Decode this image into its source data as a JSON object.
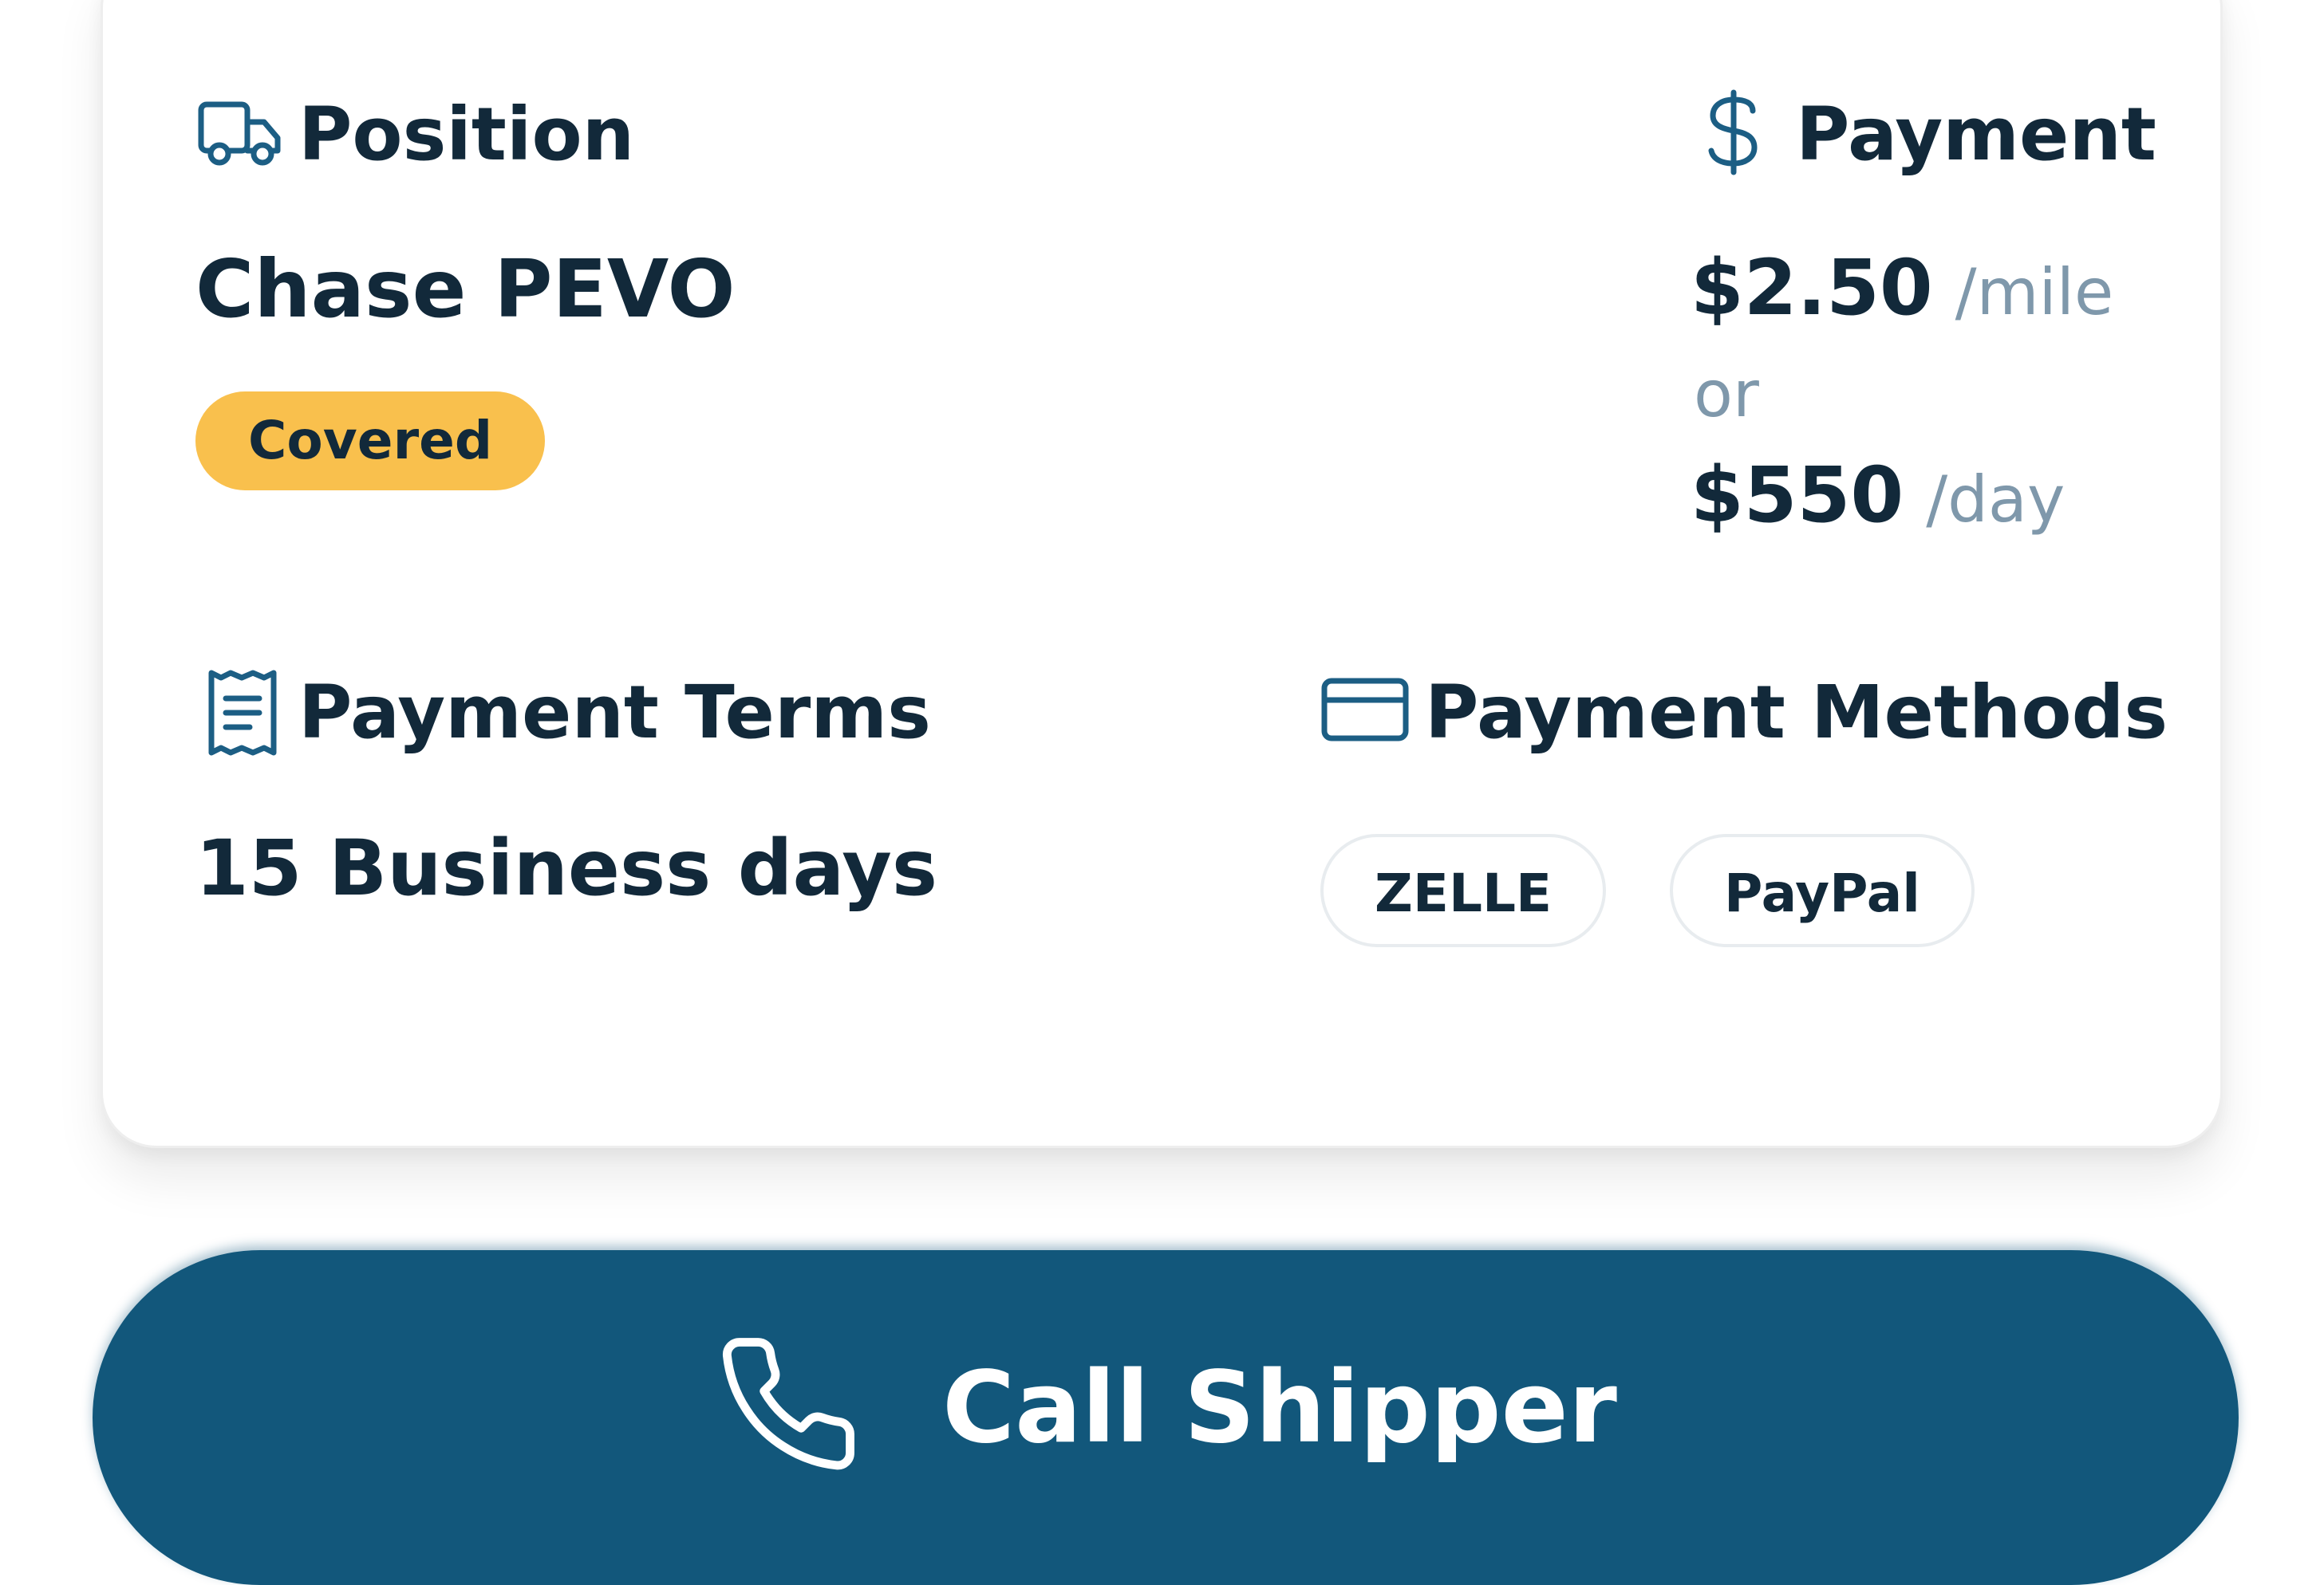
{
  "position": {
    "title": "Position",
    "icon": "truck-icon",
    "value": "Chase PEVO",
    "badge": "Covered",
    "badge_color": "#f9c04d"
  },
  "payment": {
    "title": "Payment",
    "icon": "dollar-icon",
    "rate_per_mile": "$2.50",
    "rate_per_mile_unit": "/mile",
    "or_text": "or",
    "rate_per_day": "$550",
    "rate_per_day_unit": "/day"
  },
  "payment_terms": {
    "title": "Payment Terms",
    "icon": "receipt-icon",
    "value": "15 Business days"
  },
  "payment_methods": {
    "title": "Payment Methods",
    "icon": "credit-card-icon",
    "methods": [
      "ZELLE",
      "PayPal"
    ]
  },
  "call_button": {
    "label": "Call Shipper",
    "icon": "phone-icon",
    "color": "#12577b"
  },
  "colors": {
    "text_primary": "#12293a",
    "text_muted": "#7f98ab",
    "icon_accent": "#1c5e84"
  }
}
